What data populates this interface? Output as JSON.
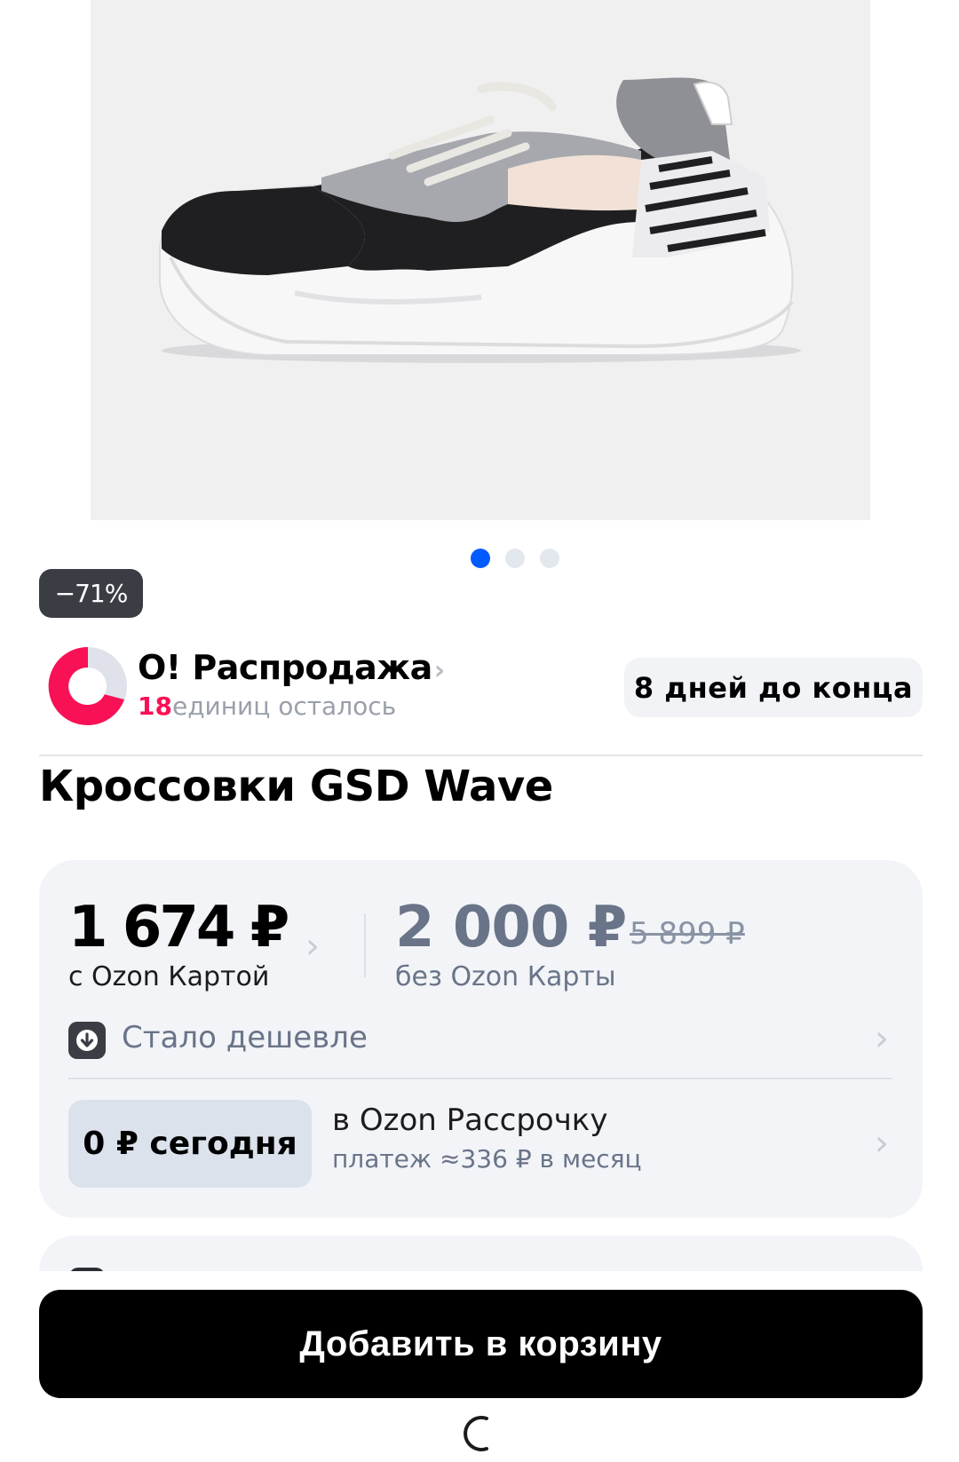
{
  "gallery": {
    "image_alt": "sneaker-photo",
    "dots_total": 3,
    "dots_active": 1
  },
  "badge": {
    "discount": "−71%"
  },
  "promo": {
    "title": "O! Распродажа",
    "chevron": "›",
    "count": "18",
    "count_suffix": "единиц осталось",
    "days_left": "8 дней до конца"
  },
  "product": {
    "title": "Кроссовки GSD Wave"
  },
  "price": {
    "card_price": "1 674 ₽",
    "card_label": "с Ozon Картой",
    "regular_price": "2 000 ₽",
    "old_price": "5 899 ₽",
    "regular_label": "без Ozon Карты",
    "cheaper_label": "Стало дешевле",
    "installment_chip": "0 ₽ сегодня",
    "installment_title": "в Ozon Рассрочку",
    "installment_sub": "платеж ≈336 ₽ в месяц",
    "chevron": "›"
  },
  "actions": {
    "add_to_cart": "Добавить в корзину"
  },
  "colors": {
    "accent_blue": "#005bff",
    "promo_pink": "#f91155",
    "button_black": "#000000"
  }
}
